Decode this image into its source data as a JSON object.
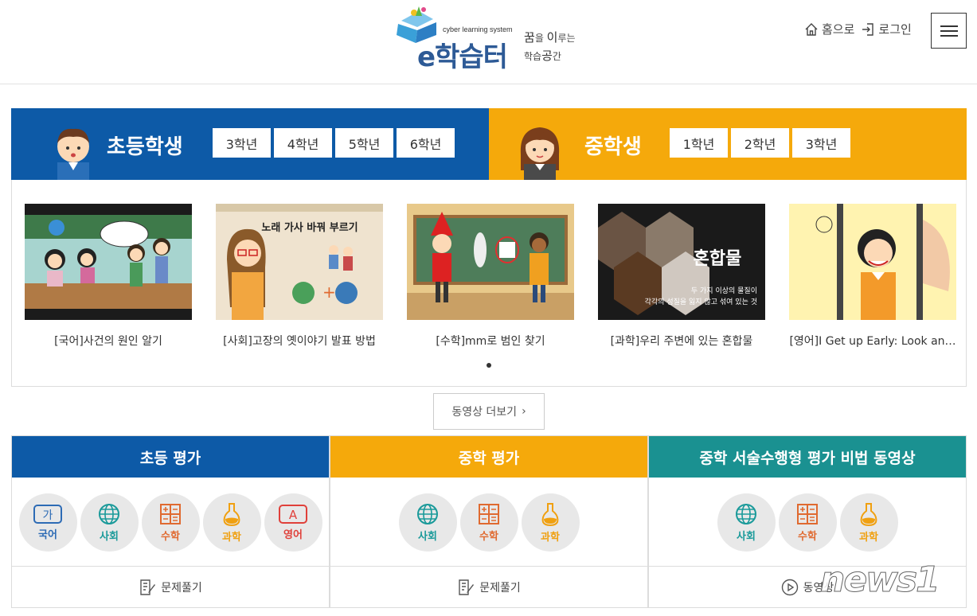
{
  "header": {
    "logo_tagline": "cyber learning system",
    "logo_name": "e학습터",
    "slogan_line1_a": "꿈",
    "slogan_line1_b": "을 ",
    "slogan_line1_c": "이",
    "slogan_line1_d": "루는",
    "slogan_line2_a": "학습",
    "slogan_line2_b": "공",
    "slogan_line2_c": "간",
    "home_label": "홈으로",
    "login_label": "로그인"
  },
  "elementary": {
    "title": "초등학생",
    "grades": [
      "3학년",
      "4학년",
      "5학년",
      "6학년"
    ],
    "color": "#0d5aa7"
  },
  "middle": {
    "title": "중학생",
    "grades": [
      "1학년",
      "2학년",
      "3학년"
    ],
    "color": "#f5a90b"
  },
  "videos": [
    {
      "caption": "[국어]사건의 원인 알기"
    },
    {
      "caption": "[사회]고장의 옛이야기 발표 방법",
      "thumb_text": "노래 가사 바꿔 부르기"
    },
    {
      "caption": "[수학]mm로 범인 찾기"
    },
    {
      "caption": "[과학]우리 주변에 있는 혼합물",
      "thumb_title": "혼합물",
      "thumb_line1": "두 가지 이상의 물질이",
      "thumb_line2": "각각의 성질을 잃지 않고 섞여 있는 것"
    },
    {
      "caption": "[영어]I Get up Early: Look an…"
    }
  ],
  "more_videos_label": "동영상 더보기",
  "panels": [
    {
      "title": "초등 평가",
      "color": "#0d5aa7",
      "subjects": [
        "국어",
        "사회",
        "수학",
        "과학",
        "영어"
      ],
      "footer": "문제풀기"
    },
    {
      "title": "중학 평가",
      "color": "#f5a90b",
      "subjects": [
        "사회",
        "수학",
        "과학"
      ],
      "footer": "문제풀기"
    },
    {
      "title": "중학 서술수행형 평가 비법 동영상",
      "color": "#1a9191",
      "subjects": [
        "사회",
        "수학",
        "과학"
      ],
      "footer": "동영상"
    }
  ],
  "subject_colors": {
    "국어": "#2d6bb5",
    "사회": "#1a9a9a",
    "수학": "#e06a30",
    "과학": "#f0a010",
    "영어": "#e0403a"
  },
  "watermark": "news1"
}
